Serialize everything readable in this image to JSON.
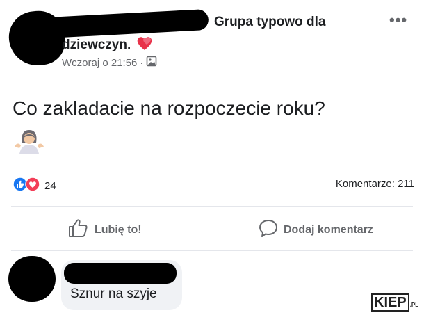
{
  "post": {
    "group_name_line1": "Grupa typowo dla",
    "group_name_line2": "dziewczyn.",
    "timestamp": "Wczoraj o 21:56",
    "separator": "·",
    "text": "Co zakladacie na rozpoczecie roku?",
    "reaction_count": "24",
    "comments_count": "Komentarze: 211"
  },
  "actions": {
    "like_label": "Lubię to!",
    "comment_label": "Dodaj komentarz"
  },
  "comment": {
    "text": "Sznur na szyje"
  },
  "watermark": {
    "logo": "KIEP",
    "suffix": ".PL"
  },
  "colors": {
    "like_blue": "#1877f2",
    "love_red": "#f33e58",
    "heart_emoji": "#e8334a",
    "muted_text": "#65676b",
    "bubble_bg": "#f0f2f5"
  },
  "icons": [
    "more-icon",
    "heart-icon",
    "group-photo-icon",
    "shrug-emoji-icon",
    "like-reaction-icon",
    "love-reaction-icon",
    "thumbs-up-icon",
    "comment-icon"
  ]
}
